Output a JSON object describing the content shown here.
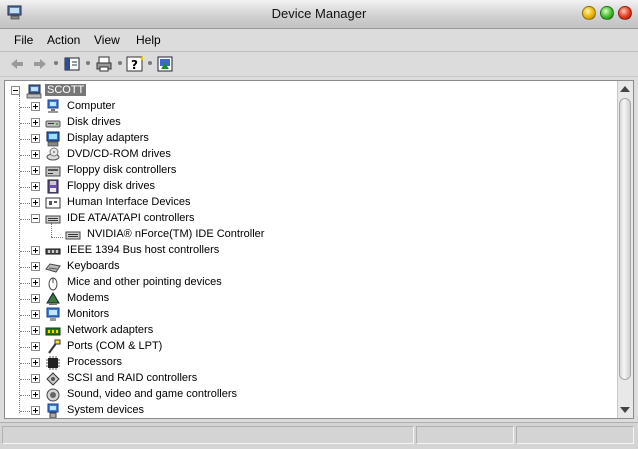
{
  "window": {
    "title": "Device Manager",
    "title_icon": "device-manager-icon"
  },
  "menu": [
    "File",
    "Action",
    "View",
    "Help"
  ],
  "toolbar": [
    "back-arrow-icon",
    "forward-arrow-icon",
    "show-hide-tree-icon",
    "print-icon",
    "help-icon",
    "properties-icon"
  ],
  "tree": {
    "root": "SCOTT",
    "items": [
      {
        "label": "Computer",
        "icon": "computer-icon"
      },
      {
        "label": "Disk drives",
        "icon": "disk-drive-icon"
      },
      {
        "label": "Display adapters",
        "icon": "display-adapter-icon"
      },
      {
        "label": "DVD/CD-ROM drives",
        "icon": "cdrom-icon"
      },
      {
        "label": "Floppy disk controllers",
        "icon": "floppy-controller-icon"
      },
      {
        "label": "Floppy disk drives",
        "icon": "floppy-drive-icon"
      },
      {
        "label": "Human Interface Devices",
        "icon": "hid-icon"
      },
      {
        "label": "IDE ATA/ATAPI controllers",
        "icon": "ide-controller-icon",
        "expanded": true,
        "children": [
          {
            "label": "NVIDIA® nForce(TM) IDE Controller",
            "icon": "ide-controller-icon"
          }
        ]
      },
      {
        "label": "IEEE 1394 Bus host controllers",
        "icon": "ieee1394-icon"
      },
      {
        "label": "Keyboards",
        "icon": "keyboard-icon"
      },
      {
        "label": "Mice and other pointing devices",
        "icon": "mouse-icon"
      },
      {
        "label": "Modems",
        "icon": "modem-icon"
      },
      {
        "label": "Monitors",
        "icon": "monitor-icon"
      },
      {
        "label": "Network adapters",
        "icon": "network-adapter-icon"
      },
      {
        "label": "Ports (COM & LPT)",
        "icon": "port-icon"
      },
      {
        "label": "Processors",
        "icon": "processor-icon"
      },
      {
        "label": "SCSI and RAID controllers",
        "icon": "scsi-icon"
      },
      {
        "label": "Sound, video and game controllers",
        "icon": "sound-icon"
      },
      {
        "label": "System devices",
        "icon": "system-device-icon"
      }
    ]
  },
  "statusbar": [
    "",
    "",
    ""
  ]
}
